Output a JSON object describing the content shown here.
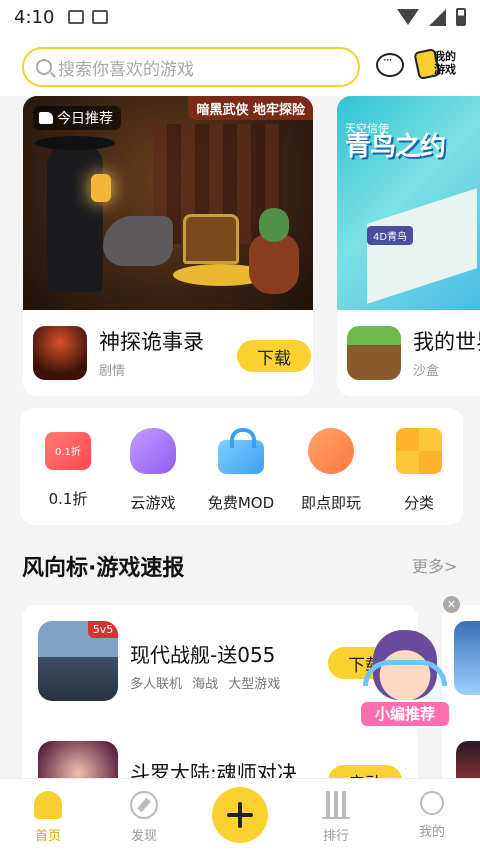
{
  "status_bar": {
    "time": "4:10"
  },
  "search": {
    "placeholder": "搜索你喜欢的游戏"
  },
  "header": {
    "my_games_label": "我的游戏"
  },
  "banners": [
    {
      "tag": "今日推荐",
      "corner_label": "暗黑武侠 地牢探险",
      "game_name": "神探诡事录",
      "category": "剧情",
      "button": "下载"
    },
    {
      "title": "青鸟之约",
      "subtitle": "天空信使",
      "badge": "4D青鸟",
      "game_name": "我的世界",
      "category": "沙盒"
    }
  ],
  "categories": [
    {
      "label": "0.1折",
      "icon": "discount-ticket-icon"
    },
    {
      "label": "云游戏",
      "icon": "cloud-gamepad-icon"
    },
    {
      "label": "免费MOD",
      "icon": "lock-icon"
    },
    {
      "label": "即点即玩",
      "icon": "pacman-icon"
    },
    {
      "label": "分类",
      "icon": "grid-icon"
    }
  ],
  "section": {
    "title": "风向标·游戏速报",
    "more": "更多>"
  },
  "game_list": [
    {
      "name": "现代战舰-送055",
      "badge": "5v5",
      "tags": "多人联机 海战 大型游戏",
      "button": "下载"
    },
    {
      "name": "斗罗大陆:魂师对决",
      "button": "启动"
    }
  ],
  "floating": {
    "label": "小编推荐"
  },
  "bottom_nav": [
    {
      "label": "首页",
      "active": true
    },
    {
      "label": "发现"
    },
    {
      "label": "排行"
    },
    {
      "label": "我的"
    }
  ],
  "colors": {
    "accent": "#f9d22f",
    "active_nav": "#e0a800"
  }
}
